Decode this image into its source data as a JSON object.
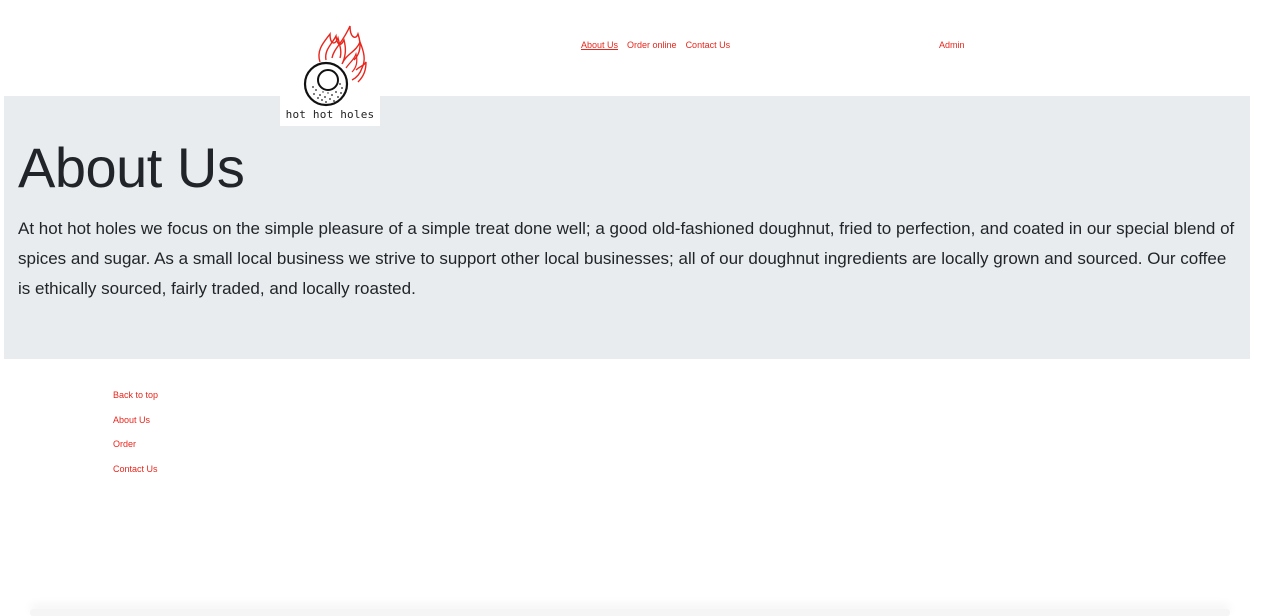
{
  "brand": {
    "name": "hot hot holes",
    "accent": "#e8261c",
    "logo_icon": "flaming-doughnut-icon"
  },
  "nav": {
    "items": [
      {
        "label": "About Us",
        "active": true
      },
      {
        "label": "Order online",
        "active": false
      },
      {
        "label": "Contact Us",
        "active": false
      }
    ],
    "admin_label": "Admin"
  },
  "hero": {
    "background": "#e9ecef",
    "title": "About Us",
    "text": "At hot hot holes we focus on the simple pleasure of a simple treat done well; a good old-fashioned doughnut, fried to perfection, and coated in our special blend of spices and sugar. As a small local business we strive to support other local businesses; all of our doughnut ingredients are locally grown and sourced. Our coffee is ethically sourced, fairly traded, and locally roasted."
  },
  "footer": {
    "links": [
      {
        "label": "Back to top"
      },
      {
        "label": "About Us"
      },
      {
        "label": "Order"
      },
      {
        "label": "Contact Us"
      }
    ]
  }
}
